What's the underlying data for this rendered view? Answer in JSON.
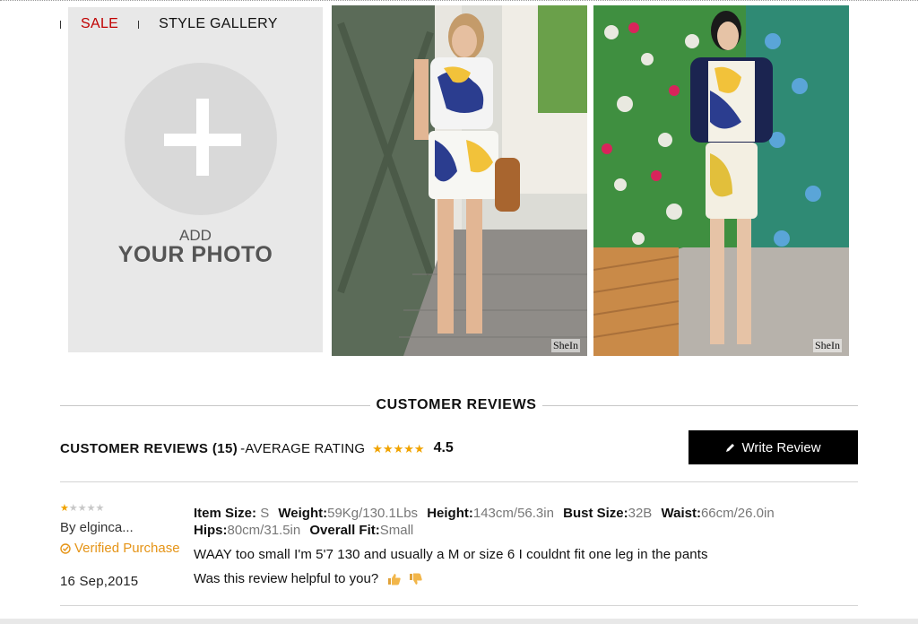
{
  "tabs": {
    "sale": "SALE",
    "style_gallery": "STYLE GALLERY"
  },
  "add_photo": {
    "line1": "ADD",
    "line2": "YOUR PHOTO"
  },
  "gallery": {
    "watermark": "SheIn"
  },
  "reviews_section": {
    "title": "CUSTOMER REVIEWS",
    "summary_count": "CUSTOMER REVIEWS (15)",
    "summary_avg_label": " -AVERAGE RATING",
    "average_rating": "4.5",
    "write_review_label": "Write Review"
  },
  "review": {
    "rating": 1,
    "reviewer": "By elginca...",
    "verified": "Verified Purchase",
    "date": "16 Sep,2015",
    "item_size_label": "Item Size:",
    "item_size": "S",
    "weight_label": "Weight:",
    "weight": "59Kg/130.1Lbs",
    "height_label": "Height:",
    "height": "143cm/56.3in",
    "bust_label": "Bust Size:",
    "bust": "32B",
    "waist_label": "Waist:",
    "waist": "66cm/26.0in",
    "hips_label": "Hips:",
    "hips": "80cm/31.5in",
    "fit_label": "Overall Fit:",
    "fit": "Small",
    "text": "WAAY too small I'm 5'7 130 and usually a M or size 6 I couldnt fit one leg in the pants",
    "helpful_prompt": "Was this review helpful to you?"
  },
  "colors": {
    "sale": "#c00000",
    "star": "#f0a300",
    "verified": "#e59417",
    "button": "#000000"
  },
  "icons": [
    "plus-icon",
    "pencil-icon",
    "star-icon",
    "check-icon",
    "thumbs-up-icon",
    "thumbs-down-icon"
  ]
}
